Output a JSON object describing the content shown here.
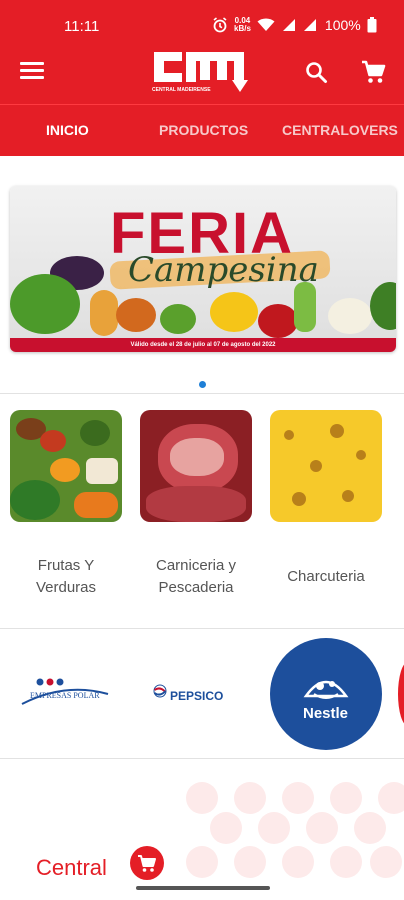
{
  "status_bar": {
    "time": "11:11",
    "net_speed_value": "0.04",
    "net_speed_unit": "kB/s",
    "battery": "100%"
  },
  "app_bar": {
    "logo_text": "cm",
    "logo_subtext": "CENTRAL MADEIRENSE"
  },
  "tabs": [
    {
      "label": "INICIO",
      "active": true
    },
    {
      "label": "PRODUCTOS",
      "active": false
    },
    {
      "label": "CENTRALOVERS",
      "active": false
    }
  ],
  "banner": {
    "title": "FERIA",
    "subtitle": "Campesina",
    "validity": "Válido desde el 28 de julio al 07 de agosto del 2022"
  },
  "categories": [
    {
      "label_line1": "Frutas Y",
      "label_line2": "Verduras"
    },
    {
      "label_line1": "Carniceria y",
      "label_line2": "Pescaderia"
    },
    {
      "label_line1": "Charcuteria",
      "label_line2": ""
    }
  ],
  "brands": [
    {
      "name": "EMPRESAS POLAR"
    },
    {
      "name": "PEPSICO"
    },
    {
      "name": "Nestle"
    }
  ],
  "footer": {
    "central_label": "Central"
  },
  "colors": {
    "brand_red": "#e41e26",
    "indicator_blue": "#1e7fd6",
    "nestle_blue": "#1d4f9c"
  }
}
